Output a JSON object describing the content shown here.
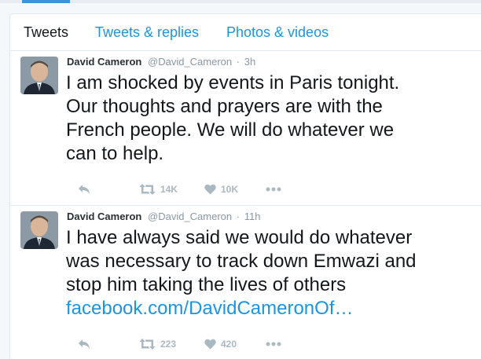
{
  "tabs": [
    {
      "label": "Tweets"
    },
    {
      "label": "Tweets & replies"
    },
    {
      "label": "Photos & videos"
    }
  ],
  "tweets": [
    {
      "name": "David Cameron",
      "handle": "@David_Cameron",
      "separator": "·",
      "time": "3h",
      "lines": [
        "I am shocked by events in Paris tonight.",
        "Our thoughts and prayers are with the",
        "French people. We will do whatever we",
        "can to help."
      ],
      "link": "",
      "retweets": "14K",
      "likes": "10K"
    },
    {
      "name": "David Cameron",
      "handle": "@David_Cameron",
      "separator": "·",
      "time": "11h",
      "lines": [
        "I have always said we would do whatever",
        "was necessary to track down Emwazi and",
        "stop him taking the lives of others"
      ],
      "link": "facebook.com/DavidCameronOf…",
      "retweets": "223",
      "likes": "420"
    }
  ],
  "colors": {
    "accent": "#1b95e0",
    "text": "#14171a",
    "muted": "#8899a6",
    "icon": "#aab8c2"
  },
  "icons": {
    "reply": "reply-icon",
    "retweet": "retweet-icon",
    "like": "heart-icon",
    "more": "more-icon"
  }
}
